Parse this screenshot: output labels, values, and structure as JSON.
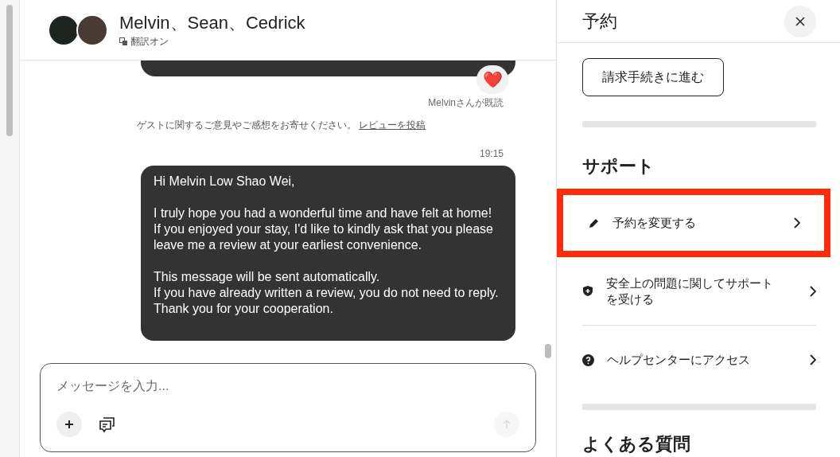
{
  "conversation": {
    "title": "Melvin、Sean、Cedrick",
    "translation": "翻訳オン"
  },
  "messages": [
    {
      "kind": "reaction",
      "reaction": "❤️",
      "read_receipt": "Melvinさんが既読"
    },
    {
      "kind": "notice",
      "text": "ゲストに関するご意見やご感想をお寄せください。",
      "link": "レビューを投稿"
    },
    {
      "kind": "sent",
      "time": "19:15",
      "paragraphs": [
        "Hi Melvin Low Shao Wei,",
        "I truly hope you had a wonderful time and have felt at home!\nIf you enjoyed your stay, I'd like to kindly ask that you please leave me a review at your earliest convenience.",
        "This message will be sent automatically.\nIf you have already written a review, you do not need to reply.\nThank you for your cooperation."
      ]
    }
  ],
  "composer": {
    "placeholder": "メッセージを入力..."
  },
  "panel": {
    "title": "予約",
    "action_button": "請求手続きに進む",
    "support_heading": "サポート",
    "support_items": [
      {
        "kind": "edit",
        "label": "予約を変更する",
        "highlighted": true
      },
      {
        "kind": "safety",
        "label": "安全上の問題に関してサポートを受ける",
        "highlighted": false
      },
      {
        "kind": "help",
        "label": "ヘルプセンターにアクセス",
        "highlighted": false
      }
    ],
    "faq_heading": "よくある質問"
  }
}
